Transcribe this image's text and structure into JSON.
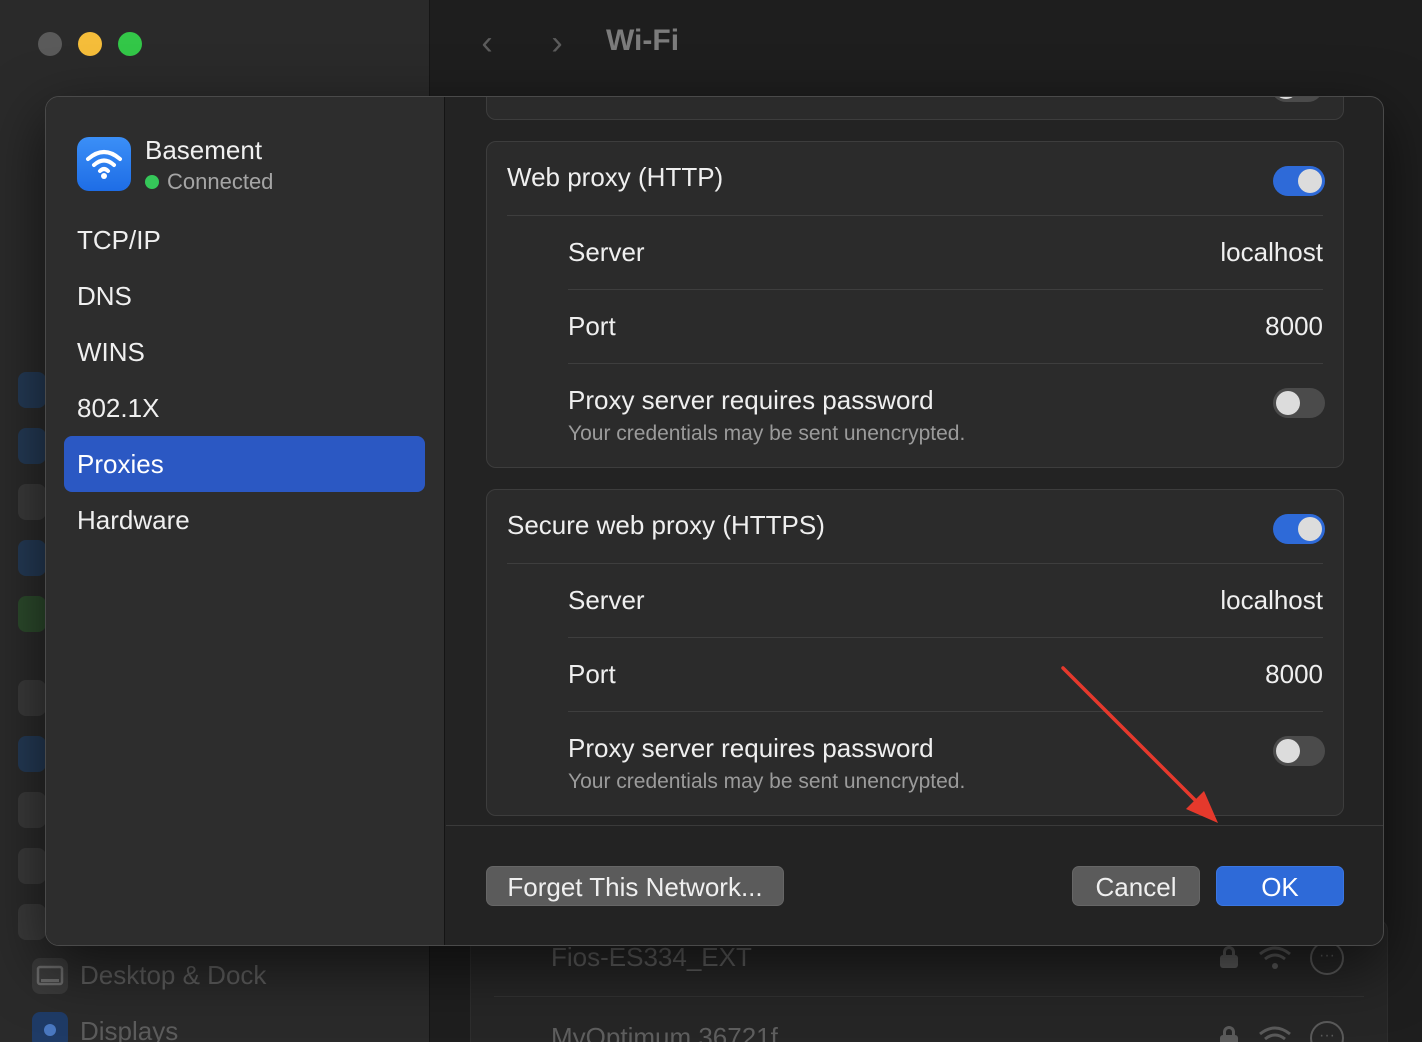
{
  "window": {
    "title": "Wi-Fi",
    "back_glyph": "‹",
    "forward_glyph": "›"
  },
  "background_list": {
    "networks": [
      {
        "name": "Fios-ES334_EXT",
        "secured": true
      },
      {
        "name": "MyOptimum 36721f",
        "secured": true
      }
    ],
    "more_glyph": "···"
  },
  "background_sidebar": {
    "items": [
      {
        "label": "Desktop & Dock",
        "icon": "desktop-icon"
      },
      {
        "label": "Displays",
        "icon": "sun-icon"
      }
    ]
  },
  "sheet": {
    "network": {
      "name": "Basement",
      "status": "Connected",
      "icon": "wifi-icon",
      "status_color": "#35c759"
    },
    "sidebar": {
      "items": [
        {
          "label": "TCP/IP",
          "selected": false
        },
        {
          "label": "DNS",
          "selected": false
        },
        {
          "label": "WINS",
          "selected": false
        },
        {
          "label": "802.1X",
          "selected": false
        },
        {
          "label": "Proxies",
          "selected": true
        },
        {
          "label": "Hardware",
          "selected": false
        }
      ]
    },
    "http_proxy": {
      "title": "Web proxy (HTTP)",
      "enabled": true,
      "server_label": "Server",
      "server_value": "localhost",
      "port_label": "Port",
      "port_value": "8000",
      "password_label": "Proxy server requires password",
      "password_note": "Your credentials may be sent unencrypted.",
      "password_required": false
    },
    "https_proxy": {
      "title": "Secure web proxy (HTTPS)",
      "enabled": true,
      "server_label": "Server",
      "server_value": "localhost",
      "port_label": "Port",
      "port_value": "8000",
      "password_label": "Proxy server requires password",
      "password_note": "Your credentials may be sent unencrypted.",
      "password_required": false
    },
    "footer": {
      "forget_label": "Forget This Network...",
      "cancel_label": "Cancel",
      "ok_label": "OK"
    }
  },
  "colors": {
    "accent": "#2e6ad8",
    "selection": "#2b58c3",
    "annotation_arrow": "#e5392c"
  }
}
